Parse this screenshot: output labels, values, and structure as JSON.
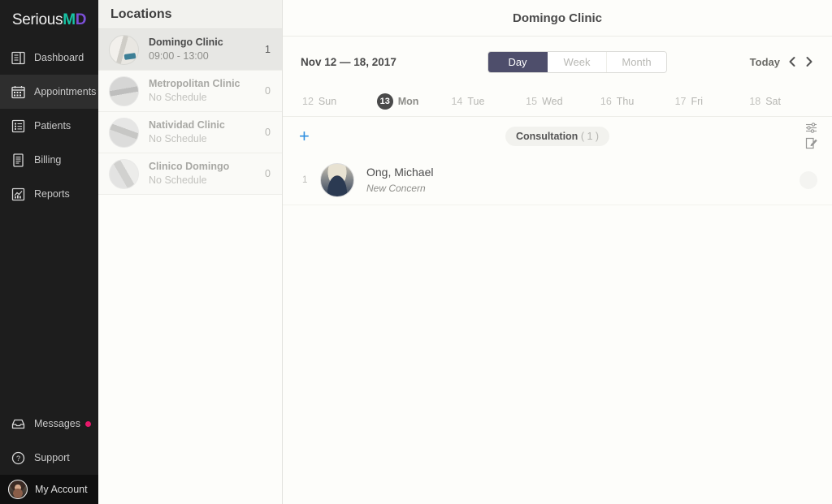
{
  "sidebar": {
    "logo": {
      "part1": "Serious",
      "part2": "M",
      "part3": "D"
    },
    "items": [
      {
        "label": "Dashboard",
        "icon": "dashboard-icon"
      },
      {
        "label": "Appointments",
        "icon": "calendar-icon"
      },
      {
        "label": "Patients",
        "icon": "list-icon"
      },
      {
        "label": "Billing",
        "icon": "document-icon"
      },
      {
        "label": "Reports",
        "icon": "chart-icon"
      }
    ],
    "bottom": [
      {
        "label": "Messages",
        "icon": "inbox-icon",
        "badge_color": "#e6186a"
      },
      {
        "label": "Support",
        "icon": "question-circle-icon"
      }
    ],
    "account": {
      "label": "My Account",
      "icon": "avatar"
    }
  },
  "locations": {
    "header": "Locations",
    "items": [
      {
        "name": "Domingo Clinic",
        "schedule": "09:00 - 13:00",
        "count": "1",
        "selected": true
      },
      {
        "name": "Metropolitan Clinic",
        "schedule": "No Schedule",
        "count": "0",
        "selected": false
      },
      {
        "name": "Natividad Clinic",
        "schedule": "No Schedule",
        "count": "0",
        "selected": false
      },
      {
        "name": "Clinico Domingo",
        "schedule": "No Schedule",
        "count": "0",
        "selected": false
      }
    ]
  },
  "main": {
    "title": "Domingo Clinic",
    "toolbar": {
      "date_range": "Nov 12 — 18, 2017",
      "views": [
        {
          "label": "Day",
          "active": true
        },
        {
          "label": "Week",
          "active": false
        },
        {
          "label": "Month",
          "active": false
        }
      ],
      "active_view_color": "#4e4e6b",
      "today_label": "Today",
      "prev_icon": "chevron-left-icon",
      "next_icon": "chevron-right-icon"
    },
    "daystrip": [
      {
        "num": "12",
        "dow": "Sun",
        "selected": false
      },
      {
        "num": "13",
        "dow": "Mon",
        "selected": true
      },
      {
        "num": "14",
        "dow": "Tue",
        "selected": false
      },
      {
        "num": "15",
        "dow": "Wed",
        "selected": false
      },
      {
        "num": "16",
        "dow": "Thu",
        "selected": false
      },
      {
        "num": "17",
        "dow": "Fri",
        "selected": false
      },
      {
        "num": "18",
        "dow": "Sat",
        "selected": false
      }
    ],
    "group": {
      "add_label": "+",
      "add_color": "#2f8fe0",
      "title": "Consultation",
      "count": "( 1 )",
      "filter_icon": "sliders-icon",
      "edit_icon": "edit-note-icon"
    },
    "appointments": [
      {
        "index": "1",
        "name": "Ong, Michael",
        "subtitle": "New Concern"
      }
    ]
  }
}
